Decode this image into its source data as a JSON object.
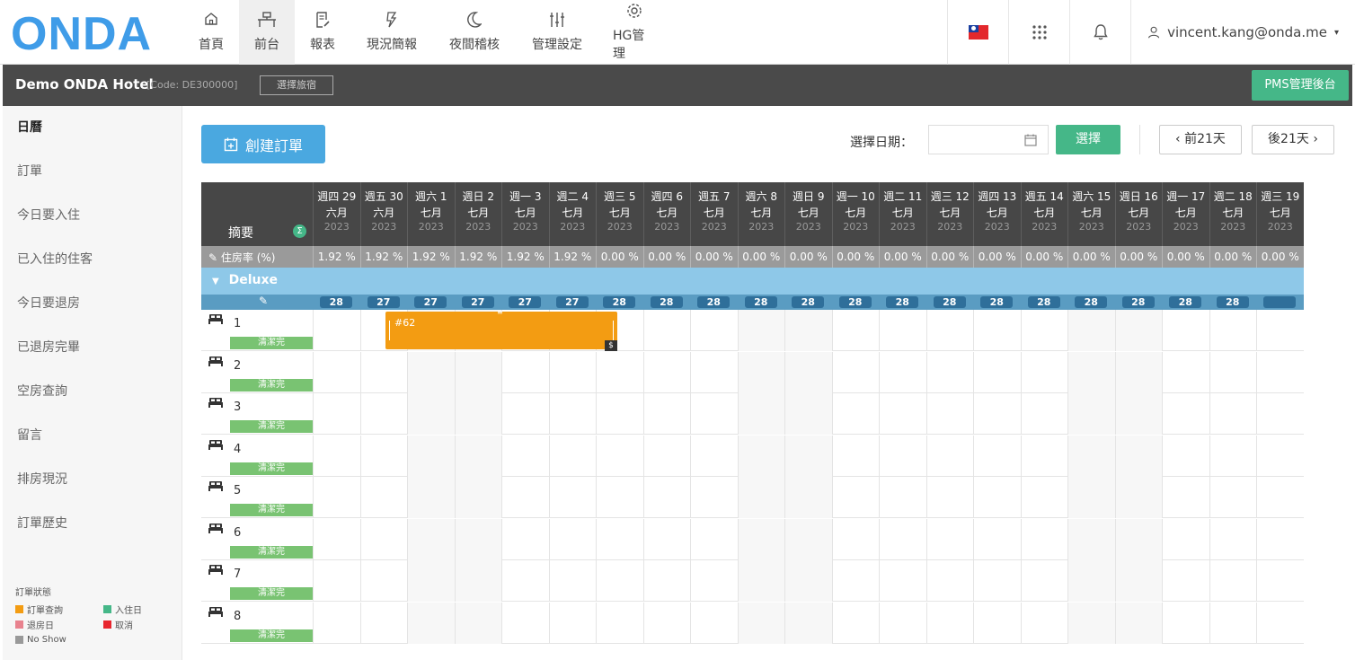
{
  "nav": {
    "logo": "ONDA",
    "items": [
      {
        "label": "首頁",
        "icon": "home-icon"
      },
      {
        "label": "前台",
        "icon": "front-desk-icon"
      },
      {
        "label": "報表",
        "icon": "report-icon"
      },
      {
        "label": "現況簡報",
        "icon": "bolt-icon"
      },
      {
        "label": "夜間稽核",
        "icon": "moon-icon"
      },
      {
        "label": "管理設定",
        "icon": "sliders-icon"
      },
      {
        "label": "HG管理",
        "icon": "gear-icon"
      }
    ],
    "active": "前台",
    "user": "vincent.kang@onda.me"
  },
  "hotel": {
    "name": "Demo ONDA Hotel",
    "code": "[Code: DE300000]",
    "select_label": "選擇旅宿",
    "pms_label": "PMS管理後台"
  },
  "sidebar": {
    "items": [
      "日曆",
      "訂單",
      "今日要入住",
      "已入住的住客",
      "今日要退房",
      "已退房完畢",
      "空房查詢",
      "留言",
      "排房現況",
      "訂單歷史"
    ],
    "active": "日曆",
    "legend": {
      "title": "訂單狀態",
      "items": [
        {
          "label": "訂單查詢",
          "color": "#f39c12"
        },
        {
          "label": "入住日",
          "color": "#45b788"
        },
        {
          "label": "退房日",
          "color": "#e8828e"
        },
        {
          "label": "取消",
          "color": "#e8262e"
        },
        {
          "label": "No Show",
          "color": "#999999"
        }
      ]
    }
  },
  "toolbar": {
    "create_label": "創建訂單",
    "date_label": "選擇日期：",
    "date_value": "",
    "select_label": "選擇",
    "prev_label": "前21天",
    "next_label": "後21天"
  },
  "calendar": {
    "summary_label": "摘要",
    "occupancy_label": "住房率 (%)",
    "days": [
      {
        "dow": "週四 29",
        "month": "六月",
        "year": "2023",
        "occ": "1.92 %",
        "avail": "28"
      },
      {
        "dow": "週五 30",
        "month": "六月",
        "year": "2023",
        "occ": "1.92 %",
        "avail": "27"
      },
      {
        "dow": "週六 1",
        "month": "七月",
        "year": "2023",
        "occ": "1.92 %",
        "avail": "27"
      },
      {
        "dow": "週日 2",
        "month": "七月",
        "year": "2023",
        "occ": "1.92 %",
        "avail": "27"
      },
      {
        "dow": "週一 3",
        "month": "七月",
        "year": "2023",
        "occ": "1.92 %",
        "avail": "27"
      },
      {
        "dow": "週二 4",
        "month": "七月",
        "year": "2023",
        "occ": "1.92 %",
        "avail": "27"
      },
      {
        "dow": "週三 5",
        "month": "七月",
        "year": "2023",
        "occ": "0.00 %",
        "avail": "28"
      },
      {
        "dow": "週四 6",
        "month": "七月",
        "year": "2023",
        "occ": "0.00 %",
        "avail": "28"
      },
      {
        "dow": "週五 7",
        "month": "七月",
        "year": "2023",
        "occ": "0.00 %",
        "avail": "28"
      },
      {
        "dow": "週六 8",
        "month": "七月",
        "year": "2023",
        "occ": "0.00 %",
        "avail": "28"
      },
      {
        "dow": "週日 9",
        "month": "七月",
        "year": "2023",
        "occ": "0.00 %",
        "avail": "28"
      },
      {
        "dow": "週一 10",
        "month": "七月",
        "year": "2023",
        "occ": "0.00 %",
        "avail": "28"
      },
      {
        "dow": "週二 11",
        "month": "七月",
        "year": "2023",
        "occ": "0.00 %",
        "avail": "28"
      },
      {
        "dow": "週三 12",
        "month": "七月",
        "year": "2023",
        "occ": "0.00 %",
        "avail": "28"
      },
      {
        "dow": "週四 13",
        "month": "七月",
        "year": "2023",
        "occ": "0.00 %",
        "avail": "28"
      },
      {
        "dow": "週五 14",
        "month": "七月",
        "year": "2023",
        "occ": "0.00 %",
        "avail": "28"
      },
      {
        "dow": "週六 15",
        "month": "七月",
        "year": "2023",
        "occ": "0.00 %",
        "avail": "28"
      },
      {
        "dow": "週日 16",
        "month": "七月",
        "year": "2023",
        "occ": "0.00 %",
        "avail": "28"
      },
      {
        "dow": "週一 17",
        "month": "七月",
        "year": "2023",
        "occ": "0.00 %",
        "avail": "28"
      },
      {
        "dow": "週二 18",
        "month": "七月",
        "year": "2023",
        "occ": "0.00 %",
        "avail": "28"
      },
      {
        "dow": "週三 19",
        "month": "七月",
        "year": "2023",
        "occ": "0.00 %",
        "avail": ""
      }
    ],
    "room_type": "Deluxe",
    "rooms": [
      {
        "number": "1",
        "status": "清潔完"
      },
      {
        "number": "2",
        "status": "清潔完"
      },
      {
        "number": "3",
        "status": "清潔完"
      },
      {
        "number": "4",
        "status": "清潔完"
      },
      {
        "number": "5",
        "status": "清潔完"
      },
      {
        "number": "6",
        "status": "清潔完"
      },
      {
        "number": "7",
        "status": "清潔完"
      },
      {
        "number": "8",
        "status": "清潔完"
      }
    ],
    "booking": {
      "id": "#62",
      "room": "1",
      "payment_icon": "$"
    }
  }
}
